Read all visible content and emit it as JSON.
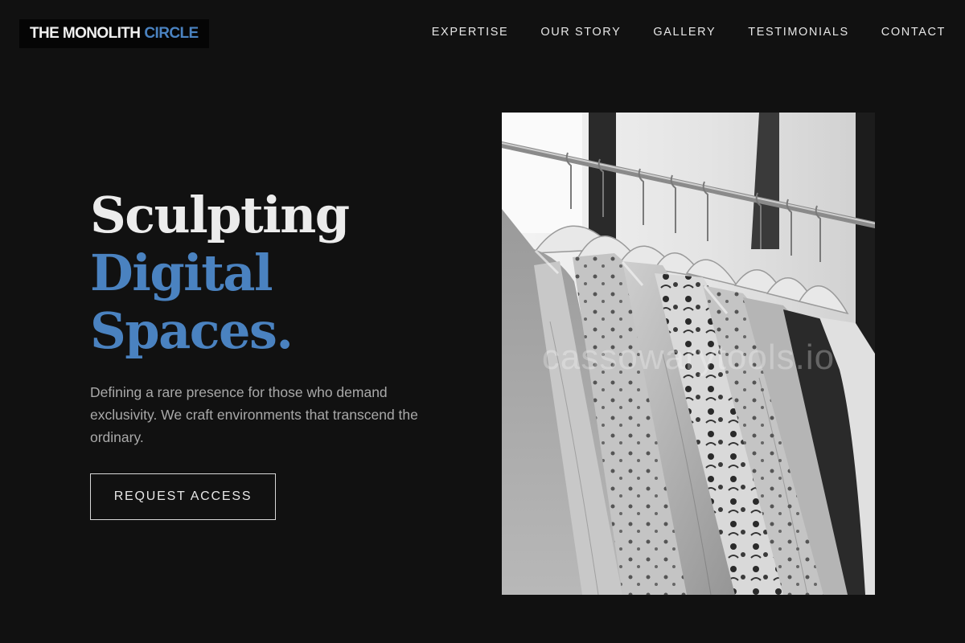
{
  "header": {
    "logo_main": "THE MONOLITH",
    "logo_accent": "CIRCLE",
    "nav": [
      {
        "label": "EXPERTISE"
      },
      {
        "label": "OUR STORY"
      },
      {
        "label": "GALLERY"
      },
      {
        "label": "TESTIMONIALS"
      },
      {
        "label": "CONTACT"
      }
    ]
  },
  "hero": {
    "headline_line1": "Sculpting",
    "headline_line2": "Digital",
    "headline_line3": "Spaces.",
    "subtext": "Defining a rare presence for those who demand exclusivity. We craft environments that transcend the ordinary.",
    "cta_label": "REQUEST ACCESS",
    "image_watermark": "cassowarytools.io"
  },
  "colors": {
    "background": "#111111",
    "accent": "#4a82c0",
    "text_primary": "#ececec",
    "text_muted": "#a9a9a9"
  },
  "icons": [
    "clothing-rack-photo"
  ]
}
